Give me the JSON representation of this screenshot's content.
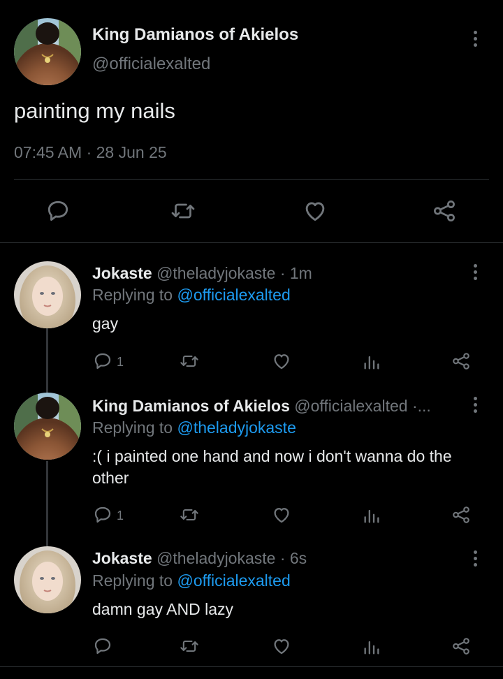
{
  "main_tweet": {
    "author_name": "King Damianos of Akielos",
    "author_handle": "@officialexalted",
    "text": "painting my nails",
    "timestamp": "07:45 AM · 28 Jun 25",
    "actions": [
      "reply-icon",
      "retweet-icon",
      "like-icon",
      "share-icon"
    ]
  },
  "replies": [
    {
      "author_name": "Jokaste",
      "meta": "@theladyjokaste · 1m",
      "replying_prefix": "Replying to",
      "replying_handle": "@officialexalted",
      "text": "gay",
      "reply_count": "1"
    },
    {
      "author_name": "King Damianos of Akielos",
      "meta": "@officialexalted ·...",
      "replying_prefix": "Replying to",
      "replying_handle": "@theladyjokaste",
      "text": ":( i painted one hand and now i don't wanna do the other",
      "reply_count": "1"
    },
    {
      "author_name": "Jokaste",
      "meta": "@theladyjokaste · 6s",
      "replying_prefix": "Replying to",
      "replying_handle": "@officialexalted",
      "text": "damn gay AND lazy",
      "reply_count": ""
    }
  ],
  "colors": {
    "background": "#000000",
    "text": "#e7e9ea",
    "muted": "#71767b",
    "link": "#1d9bf0",
    "divider": "#2f3336"
  }
}
